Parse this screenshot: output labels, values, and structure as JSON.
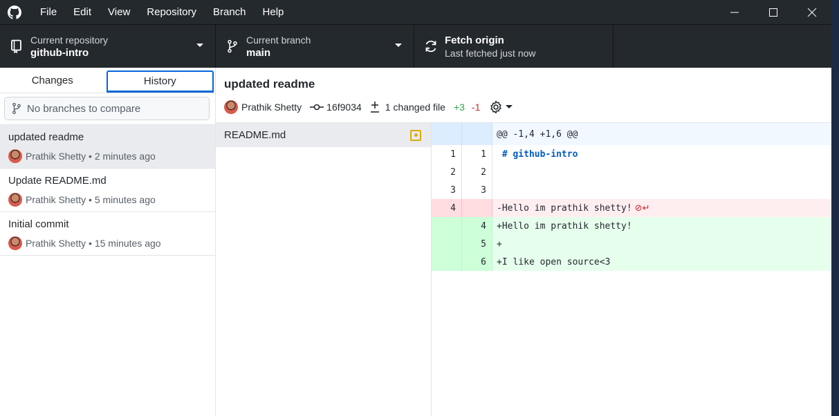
{
  "menu": [
    "File",
    "Edit",
    "View",
    "Repository",
    "Branch",
    "Help"
  ],
  "toolbar": {
    "repo_label": "Current repository",
    "repo_name": "github-intro",
    "branch_label": "Current branch",
    "branch_name": "main",
    "fetch_title": "Fetch origin",
    "fetch_sub": "Last fetched just now"
  },
  "sidebar": {
    "tabs": [
      "Changes",
      "History"
    ],
    "active_tab": "History",
    "compare_placeholder": "No branches to compare",
    "commits": [
      {
        "title": "updated readme",
        "author": "Prathik Shetty",
        "time": "2 minutes ago"
      },
      {
        "title": "Update README.md",
        "author": "Prathik Shetty",
        "time": "5 minutes ago"
      },
      {
        "title": "Initial commit",
        "author": "Prathik Shetty",
        "time": "15 minutes ago"
      }
    ]
  },
  "commit": {
    "title": "updated readme",
    "author": "Prathik Shetty",
    "sha": "16f9034",
    "changed": "1 changed file",
    "additions": "+3",
    "deletions": "-1"
  },
  "file": {
    "name": "README.md"
  },
  "diff": {
    "hunk": "@@ -1,4 +1,6 @@",
    "lines": [
      {
        "old": "1",
        "new": "1",
        "text": " # github-intro",
        "type": "ctx"
      },
      {
        "old": "2",
        "new": "2",
        "text": "",
        "type": "ctx"
      },
      {
        "old": "3",
        "new": "3",
        "text": "",
        "type": "ctx"
      },
      {
        "old": "4",
        "new": "",
        "text": "-Hello im prathik shetty!",
        "type": "del"
      },
      {
        "old": "",
        "new": "4",
        "text": "+Hello im prathik shetty!",
        "type": "add"
      },
      {
        "old": "",
        "new": "5",
        "text": "+",
        "type": "add"
      },
      {
        "old": "",
        "new": "6",
        "text": "+I like open source<3",
        "type": "add"
      }
    ]
  },
  "colors": {
    "titlebar": "#24292e",
    "accent": "#0366d6",
    "added": "#28a745",
    "removed": "#cb2431"
  }
}
